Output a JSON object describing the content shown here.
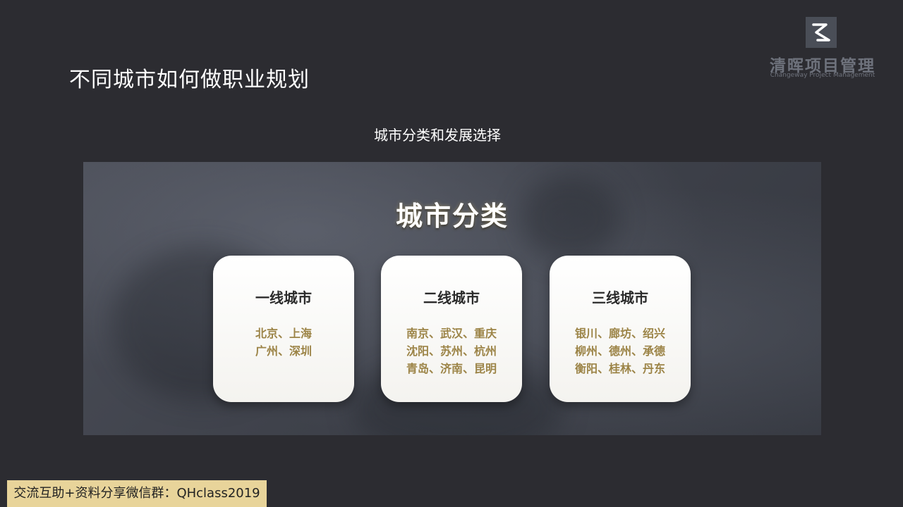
{
  "slide": {
    "title": "不同城市如何做职业规划",
    "subtitle": "城市分类和发展选择"
  },
  "logo": {
    "name_cn": "清晖项目管理",
    "name_en": "Changeway Project Management",
    "mark_color": "#4a4e57"
  },
  "panel": {
    "title": "城市分类",
    "cards": [
      {
        "title": "一线城市",
        "lines": [
          "北京、上海",
          "广州、深圳"
        ]
      },
      {
        "title": "二线城市",
        "lines": [
          "南京、武汉、重庆",
          "沈阳、苏州、杭州",
          "青岛、济南、昆明"
        ]
      },
      {
        "title": "三线城市",
        "lines": [
          "银川、廊坊、绍兴",
          "柳州、德州、承德",
          "衡阳、桂林、丹东"
        ]
      }
    ]
  },
  "footer": {
    "text": "交流互助+资料分享微信群：QHclass2019",
    "background": "#e8d49a"
  },
  "colors": {
    "background": "#2c2c31",
    "accent_gold": "#9c8447"
  }
}
